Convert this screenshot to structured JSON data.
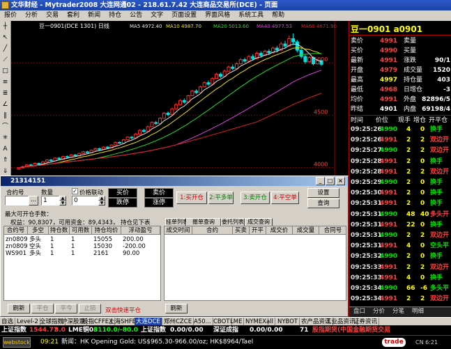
{
  "window": {
    "title": "文华财经 - Mytrader2008 大连网通02 - 218.61.7.42 大连商品交易所(DCE) - 页面"
  },
  "menu": [
    "报价",
    "分析",
    "交易",
    "套利",
    "新闻",
    "持仓",
    "公告",
    "文字",
    "页面设置",
    "界面风格",
    "系统工具",
    "帮助"
  ],
  "chart": {
    "header_label": "豆一0901(DCE 1301) 日线",
    "ma": [
      {
        "label": "MA5 4972.40",
        "color": "#e8e8e8"
      },
      {
        "label": "MA10 4987.70",
        "color": "#f0e000"
      },
      {
        "label": "MA20 5013.60",
        "color": "#20e020"
      },
      {
        "label": "MA40 4977.53",
        "color": "#e040e0"
      },
      {
        "label": "MA60 4671.90",
        "color": "#e02020"
      }
    ],
    "price_ticks": [
      "5000",
      "4500",
      "4000"
    ],
    "y_range": [
      3950,
      5320
    ],
    "candles": [
      [
        3985,
        3998,
        3978,
        4005
      ],
      [
        3996,
        4008,
        3990,
        4015
      ],
      [
        4008,
        4025,
        4002,
        4032
      ],
      [
        4025,
        4018,
        4010,
        4035
      ],
      [
        4016,
        4040,
        4012,
        4050
      ],
      [
        4040,
        4032,
        4025,
        4048
      ],
      [
        4032,
        4055,
        4028,
        4062
      ],
      [
        4055,
        4072,
        4050,
        4080
      ],
      [
        4072,
        4064,
        4058,
        4082
      ],
      [
        4064,
        4090,
        4060,
        4098
      ],
      [
        4090,
        4082,
        4075,
        4100
      ],
      [
        4080,
        4105,
        4076,
        4112
      ],
      [
        4105,
        4098,
        4090,
        4115
      ],
      [
        4098,
        4120,
        4094,
        4128
      ],
      [
        4120,
        4112,
        4105,
        4130
      ],
      [
        4110,
        4135,
        4106,
        4142
      ],
      [
        4135,
        4150,
        4130,
        4158
      ],
      [
        4150,
        4142,
        4135,
        4160
      ],
      [
        4142,
        4165,
        4138,
        4172
      ],
      [
        4165,
        4180,
        4160,
        4188
      ],
      [
        4180,
        4172,
        4165,
        4190
      ],
      [
        4172,
        4195,
        4168,
        4202
      ],
      [
        4195,
        4188,
        4180,
        4205
      ],
      [
        4188,
        4215,
        4184,
        4222
      ],
      [
        4215,
        4240,
        4210,
        4248
      ],
      [
        4240,
        4232,
        4225,
        4250
      ],
      [
        4232,
        4265,
        4228,
        4272
      ],
      [
        4265,
        4290,
        4260,
        4298
      ],
      [
        4290,
        4282,
        4272,
        4302
      ],
      [
        4282,
        4320,
        4278,
        4330
      ],
      [
        4320,
        4355,
        4315,
        4365
      ],
      [
        4355,
        4345,
        4335,
        4370
      ],
      [
        4345,
        4390,
        4340,
        4400
      ],
      [
        4390,
        4430,
        4385,
        4442
      ],
      [
        4430,
        4420,
        4405,
        4445
      ],
      [
        4420,
        4470,
        4415,
        4480
      ],
      [
        4470,
        4520,
        4465,
        4530
      ],
      [
        4520,
        4505,
        4490,
        4535
      ],
      [
        4505,
        4560,
        4500,
        4572
      ],
      [
        4560,
        4600,
        4552,
        4615
      ],
      [
        4600,
        4640,
        4595,
        4652
      ],
      [
        4640,
        4625,
        4610,
        4660
      ],
      [
        4625,
        4685,
        4620,
        4695
      ],
      [
        4685,
        4730,
        4680,
        4742
      ],
      [
        4730,
        4715,
        4700,
        4748
      ],
      [
        4715,
        4770,
        4710,
        4782
      ],
      [
        4770,
        4810,
        4765,
        4822
      ],
      [
        4810,
        4795,
        4780,
        4830
      ],
      [
        4795,
        4850,
        4790,
        4862
      ],
      [
        4850,
        4890,
        4845,
        4905
      ],
      [
        4890,
        4870,
        4855,
        4910
      ],
      [
        4870,
        4920,
        4865,
        4935
      ],
      [
        4920,
        4960,
        4915,
        4975
      ],
      [
        4960,
        4945,
        4930,
        4985
      ],
      [
        4945,
        4990,
        4940,
        5005
      ],
      [
        4990,
        5030,
        4985,
        5045
      ],
      [
        5030,
        5015,
        5000,
        5050
      ],
      [
        5015,
        5060,
        5010,
        5075
      ],
      [
        5060,
        5040,
        5020,
        5080
      ],
      [
        5040,
        5090,
        5035,
        5105
      ],
      [
        5090,
        5070,
        5050,
        5110
      ],
      [
        5070,
        5110,
        5065,
        5125
      ],
      [
        5110,
        5095,
        5075,
        5130
      ],
      [
        5095,
        5140,
        5090,
        5155
      ],
      [
        5140,
        5120,
        5100,
        5160
      ],
      [
        5120,
        5180,
        5115,
        5200
      ],
      [
        5180,
        5160,
        5140,
        5210
      ],
      [
        5160,
        5230,
        5155,
        5260
      ],
      [
        5230,
        5200,
        5170,
        5280
      ],
      [
        5200,
        5120,
        5100,
        5220
      ],
      [
        5120,
        5060,
        5040,
        5140
      ],
      [
        5060,
        5010,
        4990,
        5080
      ],
      [
        5010,
        5050,
        5000,
        5065
      ],
      [
        5050,
        4990,
        4975,
        5060
      ],
      [
        4990,
        5020,
        4985,
        5035
      ],
      [
        5020,
        4985,
        4970,
        5030
      ]
    ]
  },
  "quote": {
    "title": "豆一0901 a0901",
    "rows": [
      {
        "l1": "卖价",
        "v1": "4991",
        "c1": "#ff4040",
        "l2": "卖量",
        "v2": "",
        "c2": "#ffff00"
      },
      {
        "l1": "买价",
        "v1": "4990",
        "c1": "#ff4040",
        "l2": "买量",
        "v2": "",
        "c2": "#ffff00"
      },
      {
        "l1": "最新",
        "v1": "4991",
        "c1": "#ff4040",
        "l2": "涨跌",
        "v2": "90/1",
        "c2": "#ffffff"
      },
      {
        "l1": "开盘",
        "v1": "4979",
        "c1": "#ff4040",
        "l2": "成交量",
        "v2": "1520",
        "c2": "#ffffff"
      },
      {
        "l1": "最高",
        "v1": "4997",
        "c1": "#ffff00",
        "l2": "持仓量",
        "v2": "403",
        "c2": "#ffffff"
      },
      {
        "l1": "最低",
        "v1": "4968",
        "c1": "#ff4040",
        "l2": "日增仓",
        "v2": "-3",
        "c2": "#ffffff"
      },
      {
        "l1": "均价",
        "v1": "4991",
        "c1": "#ff4040",
        "l2": "外盘",
        "v2": "82896/5",
        "c2": "#ffffff"
      },
      {
        "l1": "昨结",
        "v1": "4901",
        "c1": "#ffffff",
        "l2": "内盘",
        "v2": "69198/4",
        "c2": "#ffffff"
      }
    ],
    "tick_header": [
      "时间",
      "价位",
      "现手",
      "增仓",
      "开平仓"
    ],
    "ticks": [
      {
        "time": "09:25:26",
        "price": "4990",
        "vol": "4",
        "oi": "0",
        "type": "换手"
      },
      {
        "time": "09:25:26",
        "price": "4991",
        "vol": "2",
        "oi": "2",
        "type": "双边开"
      },
      {
        "time": "09:25:27",
        "price": "4990",
        "vol": "2",
        "oi": "2",
        "type": "双边开"
      },
      {
        "time": "09:25:28",
        "price": "4991",
        "vol": "2",
        "oi": "0",
        "type": "换手"
      },
      {
        "time": "09:25:28",
        "price": "4991",
        "vol": "2",
        "oi": "2",
        "type": "双边开"
      },
      {
        "time": "09:25:29",
        "price": "4990",
        "vol": "2",
        "oi": "0",
        "type": "换手"
      },
      {
        "time": "09:25:30",
        "price": "4991",
        "vol": "2",
        "oi": "0",
        "type": "换手"
      },
      {
        "time": "09:25:31",
        "price": "4991",
        "vol": "2",
        "oi": "0",
        "type": "换手"
      },
      {
        "time": "09:25:31",
        "price": "4990",
        "vol": "48",
        "oi": "40",
        "type": "多头开"
      },
      {
        "time": "09:25:31",
        "price": "4991",
        "vol": "22",
        "oi": "0",
        "type": "换手"
      },
      {
        "time": "09:25:31",
        "price": "4990",
        "vol": "2",
        "oi": "2",
        "type": "双边开"
      },
      {
        "time": "09:25:31",
        "price": "4991",
        "vol": "4",
        "oi": "0",
        "type": "空头平"
      },
      {
        "time": "09:25:32",
        "price": "4990",
        "vol": "2",
        "oi": "0",
        "type": "换手"
      },
      {
        "time": "09:25:33",
        "price": "4991",
        "vol": "2",
        "oi": "2",
        "type": "双边开"
      },
      {
        "time": "09:25:33",
        "price": "4991",
        "vol": "4",
        "oi": "0",
        "type": "换手"
      },
      {
        "time": "09:25:34",
        "price": "4990",
        "vol": "66",
        "oi": "-6",
        "type": "多头平"
      },
      {
        "time": "09:25:34",
        "price": "4991",
        "vol": "2",
        "oi": "2",
        "type": "双边开"
      }
    ],
    "bottom_tabs": [
      "盘口",
      "分价",
      "分笔",
      "明细"
    ]
  },
  "dialog": {
    "title": "21314151",
    "contract_label": "合约号",
    "contract_value": "",
    "browse": "...",
    "qty_label": "数量",
    "qty_value": "1",
    "link_label": "价格联动",
    "link_checked": true,
    "price_value": "0",
    "btn_buy": "买价",
    "btn_sell": "卖价",
    "btn_rise": "跌停",
    "btn_fall": "涨停",
    "btn_buy_open": "1:买开仓",
    "btn_sell_close": "2:平多单",
    "btn_sell_open": "3:卖开仓",
    "btn_buy_close": "4:平空单",
    "btn_settings": "设置",
    "btn_query": "查询",
    "max_open": "最大可开仓手数：",
    "equity": "权益：90,8307，可用资金：89,4343， 持仓见下表",
    "pos_headers": [
      "合约号",
      "多空",
      "持仓数",
      "可用数",
      "持仓均价",
      "浮动盈亏"
    ],
    "positions": [
      {
        "c": "zn0809",
        "ls": "多头",
        "n": "1",
        "a": "1",
        "p": "15055",
        "pl": "200.00"
      },
      {
        "c": "zn0809",
        "ls": "空头",
        "n": "1",
        "a": "1",
        "p": "15030",
        "pl": "-200.00"
      },
      {
        "c": "WS901",
        "ls": "多头",
        "n": "1",
        "a": "1",
        "p": "2161",
        "pl": "90.00"
      }
    ],
    "left_buttons": [
      "刷新",
      "平仓",
      "平今",
      "止损"
    ],
    "quick_close": "双击快速平仓",
    "order_tabs": [
      "挂单列表",
      "撤单查询",
      "委托列表",
      "成交查询"
    ],
    "trade_headers": [
      "成交时间",
      "合约",
      "买卖",
      "开平",
      "成交价",
      "成交量",
      "合同号"
    ],
    "right_refresh": "刷新"
  },
  "tabbar": [
    "自选",
    "Level-2",
    "全球指数",
    "沪深股票",
    "股指CFFEX",
    "上海SHFE",
    "大连DCE",
    "郑州CZCE",
    "A50...",
    "CBOT",
    "LME",
    "NYMEX",
    "all",
    "NYBOT",
    "农产品资讯",
    "工业品资讯",
    "证券资讯"
  ],
  "ticker": {
    "t1": "上证指数",
    "t1c": "#ffffff",
    "v1": "1544.77",
    "v1c": "#ff4040",
    "v2": "8.0",
    "v2c": "#ff4040",
    "t2": "LME铜03",
    "v3": "8110.0/-80.0",
    "v3c": "#00ff00",
    "t3": "上证指数",
    "v4": "0.00/0.00",
    "t4": "深证成指",
    "v5": "0.00/0.00",
    "n": "71",
    "t5": "股指期货(中国金融期货交易"
  },
  "status": {
    "time": "09:21",
    "news": "新闻：HK Opening Gold: US$965.30-966.00/oz; HK$8964/Tael",
    "trade": "trade",
    "right": "CN 6:21"
  }
}
